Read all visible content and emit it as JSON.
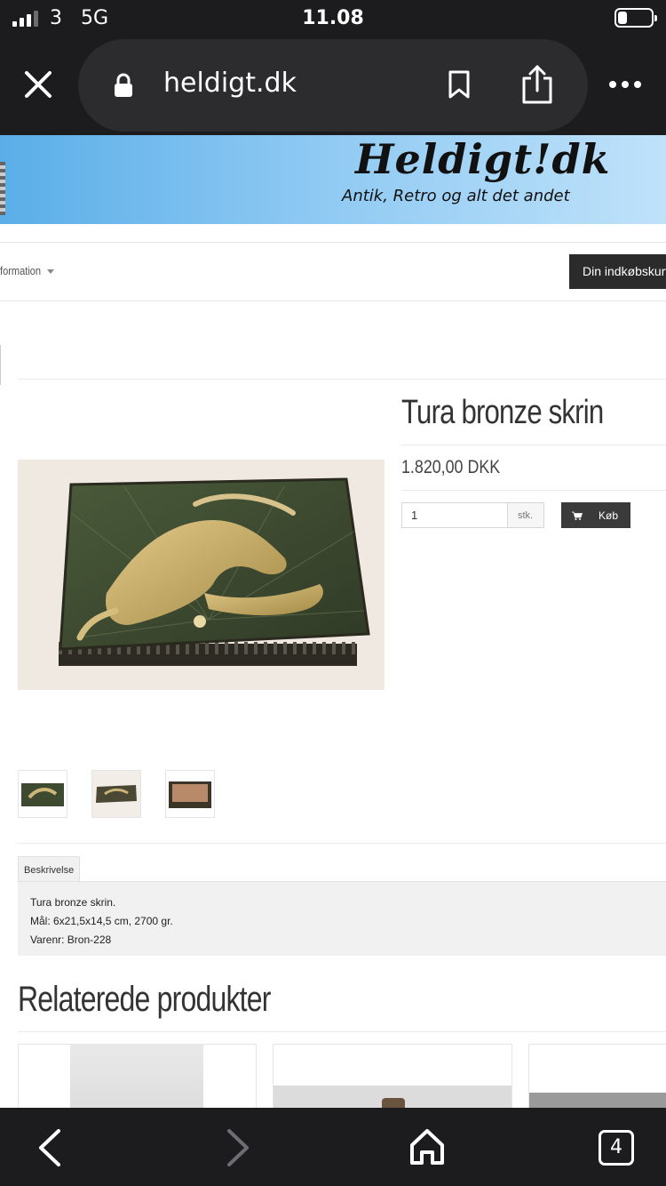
{
  "status_bar": {
    "carrier": "3",
    "network": "5G",
    "time": "11.08"
  },
  "browser": {
    "url": "heldigt.dk"
  },
  "site": {
    "logo_text": "Heldigt!dk",
    "tagline": "Antik, Retro og alt det andet",
    "nav_information": "formation",
    "cart_button": "Din indkøbskurv"
  },
  "product": {
    "title": "Tura bronze skrin",
    "price": "1.820,00 DKK",
    "quantity": "1",
    "quantity_unit": "stk.",
    "buy_label": "Køb"
  },
  "tabs": {
    "description_label": "Beskrivelse"
  },
  "description": {
    "line1": "Tura bronze skrin.",
    "line2": "Mål: 6x21,5x14,5 cm, 2700 gr.",
    "line3": "Varenr: Bron-228"
  },
  "related": {
    "title": "Relaterede produkter"
  },
  "bottom_bar": {
    "tab_count": "4"
  }
}
